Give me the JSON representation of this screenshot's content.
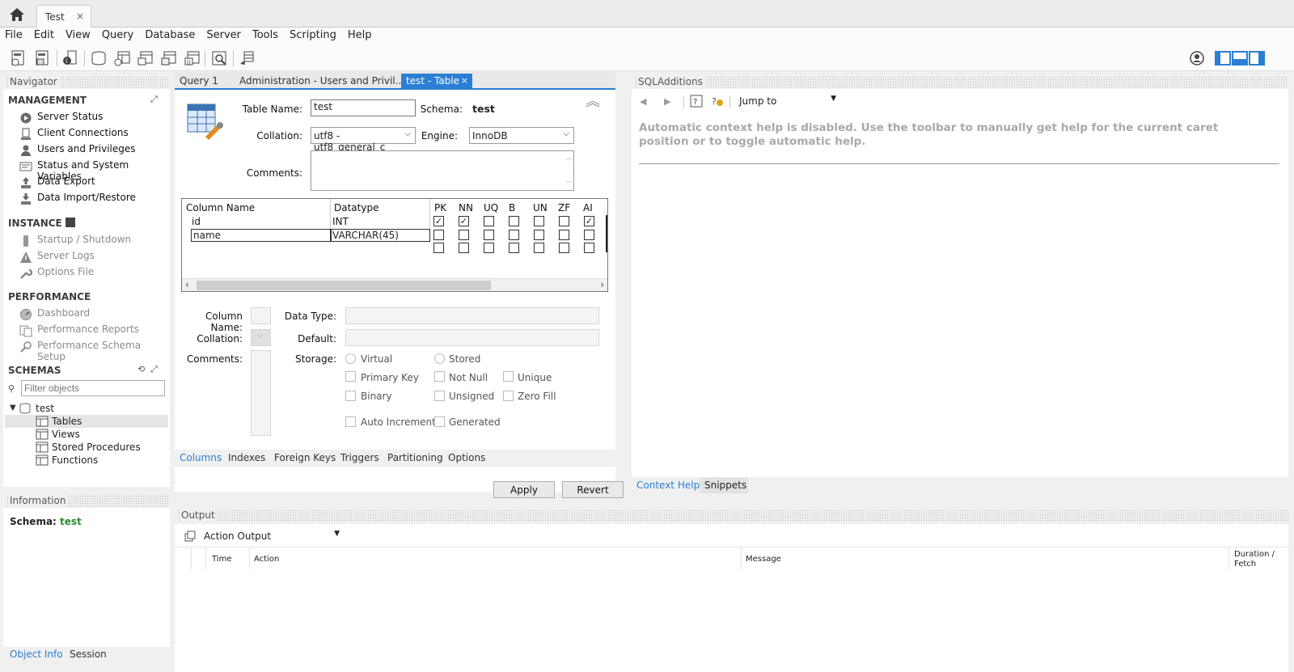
{
  "conn_tab": {
    "label": "Test",
    "close": "×"
  },
  "menu": [
    "File",
    "Edit",
    "View",
    "Query",
    "Database",
    "Server",
    "Tools",
    "Scripting",
    "Help"
  ],
  "navigator": {
    "title": "Navigator",
    "management": {
      "title": "MANAGEMENT",
      "items": [
        "Server Status",
        "Client Connections",
        "Users and Privileges",
        "Status and System Variables",
        "Data Export",
        "Data Import/Restore"
      ]
    },
    "instance": {
      "title": "INSTANCE",
      "items": [
        "Startup / Shutdown",
        "Server Logs",
        "Options File"
      ]
    },
    "performance": {
      "title": "PERFORMANCE",
      "items": [
        "Dashboard",
        "Performance Reports",
        "Performance Schema Setup"
      ]
    },
    "schemas": {
      "title": "SCHEMAS",
      "filter_placeholder": "Filter objects",
      "db": "test",
      "children": [
        "Tables",
        "Views",
        "Stored Procedures",
        "Functions"
      ]
    }
  },
  "information": {
    "title": "Information",
    "schema_label": "Schema:",
    "schema_value": "test",
    "tabs": [
      "Object Info",
      "Session"
    ]
  },
  "editor_tabs": [
    "Query 1",
    "Administration - Users and Privil...",
    "test - Table"
  ],
  "table": {
    "name_label": "Table Name:",
    "name": "test",
    "schema_label": "Schema:",
    "schema": "test",
    "collation_label": "Collation:",
    "collation": "utf8 - utf8_general_c",
    "engine_label": "Engine:",
    "engine": "InnoDB",
    "comments_label": "Comments:"
  },
  "grid": {
    "headers": [
      "Column Name",
      "Datatype",
      "PK",
      "NN",
      "UQ",
      "B",
      "UN",
      "ZF",
      "AI"
    ],
    "rows": [
      {
        "name": "id",
        "type": "INT",
        "flags": [
          true,
          true,
          false,
          false,
          false,
          false,
          true
        ]
      },
      {
        "name": "name",
        "type": "VARCHAR(45)",
        "flags": [
          false,
          false,
          false,
          false,
          false,
          false,
          false
        ]
      }
    ]
  },
  "details": {
    "column_name": "Column Name:",
    "data_type": "Data Type:",
    "collation": "Collation:",
    "default": "Default:",
    "comments": "Comments:",
    "storage": "Storage:",
    "virtual": "Virtual",
    "stored": "Stored",
    "primary_key": "Primary Key",
    "not_null": "Not Null",
    "unique": "Unique",
    "binary": "Binary",
    "unsigned": "Unsigned",
    "zero_fill": "Zero Fill",
    "auto_increment": "Auto Increment",
    "generated": "Generated"
  },
  "editor_subtabs": [
    "Columns",
    "Indexes",
    "Foreign Keys",
    "Triggers",
    "Partitioning",
    "Options"
  ],
  "buttons": {
    "apply": "Apply",
    "revert": "Revert"
  },
  "sql_additions": {
    "title": "SQLAdditions",
    "jump_to": "Jump to",
    "help_text": "Automatic context help is disabled. Use the toolbar to manually get help for the current caret position or to toggle automatic help.",
    "tabs": [
      "Context Help",
      "Snippets"
    ]
  },
  "output": {
    "title": "Output",
    "selector": "Action Output",
    "columns": [
      "Time",
      "Action",
      "Message",
      "Duration / Fetch"
    ]
  },
  "colors": {
    "accent": "#2a7fd4",
    "schema_green": "#2e8b2e"
  }
}
